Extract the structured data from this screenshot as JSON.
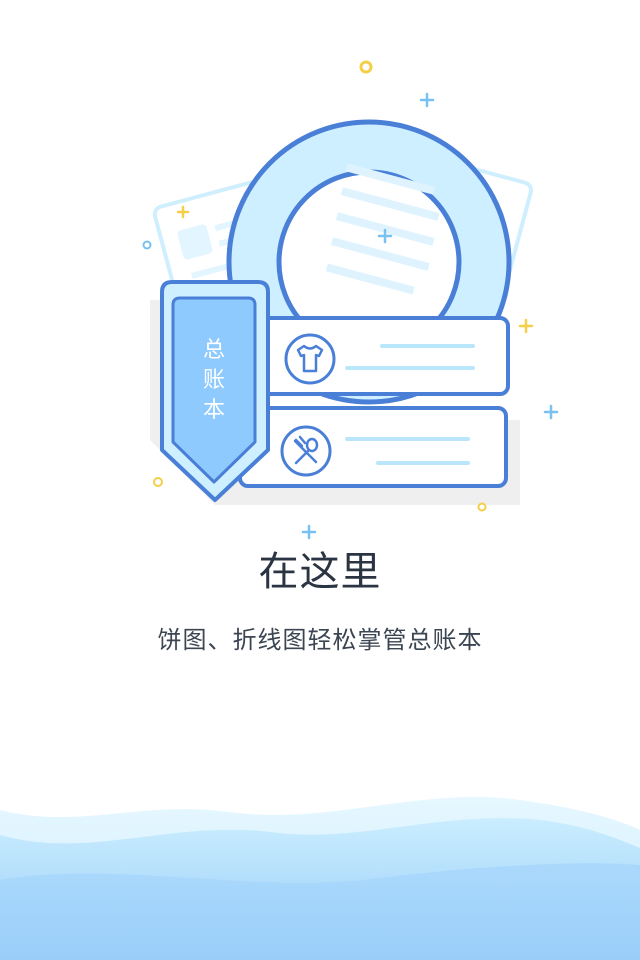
{
  "illustration": {
    "tag_label": [
      "总",
      "账",
      "本"
    ],
    "row_icons": [
      "tshirt-icon",
      "fork-spoon-icon"
    ]
  },
  "headline": "在这里",
  "subtitle": "饼图、折线图轻松掌管总账本",
  "colors": {
    "accent_blue": "#4a7fd8",
    "light_blue": "#cdefff",
    "tag_blue": "#8fcaff",
    "sparkle_yellow": "#f5cf4a",
    "sparkle_blue": "#79c1f0",
    "text_dark": "#2b3442"
  }
}
